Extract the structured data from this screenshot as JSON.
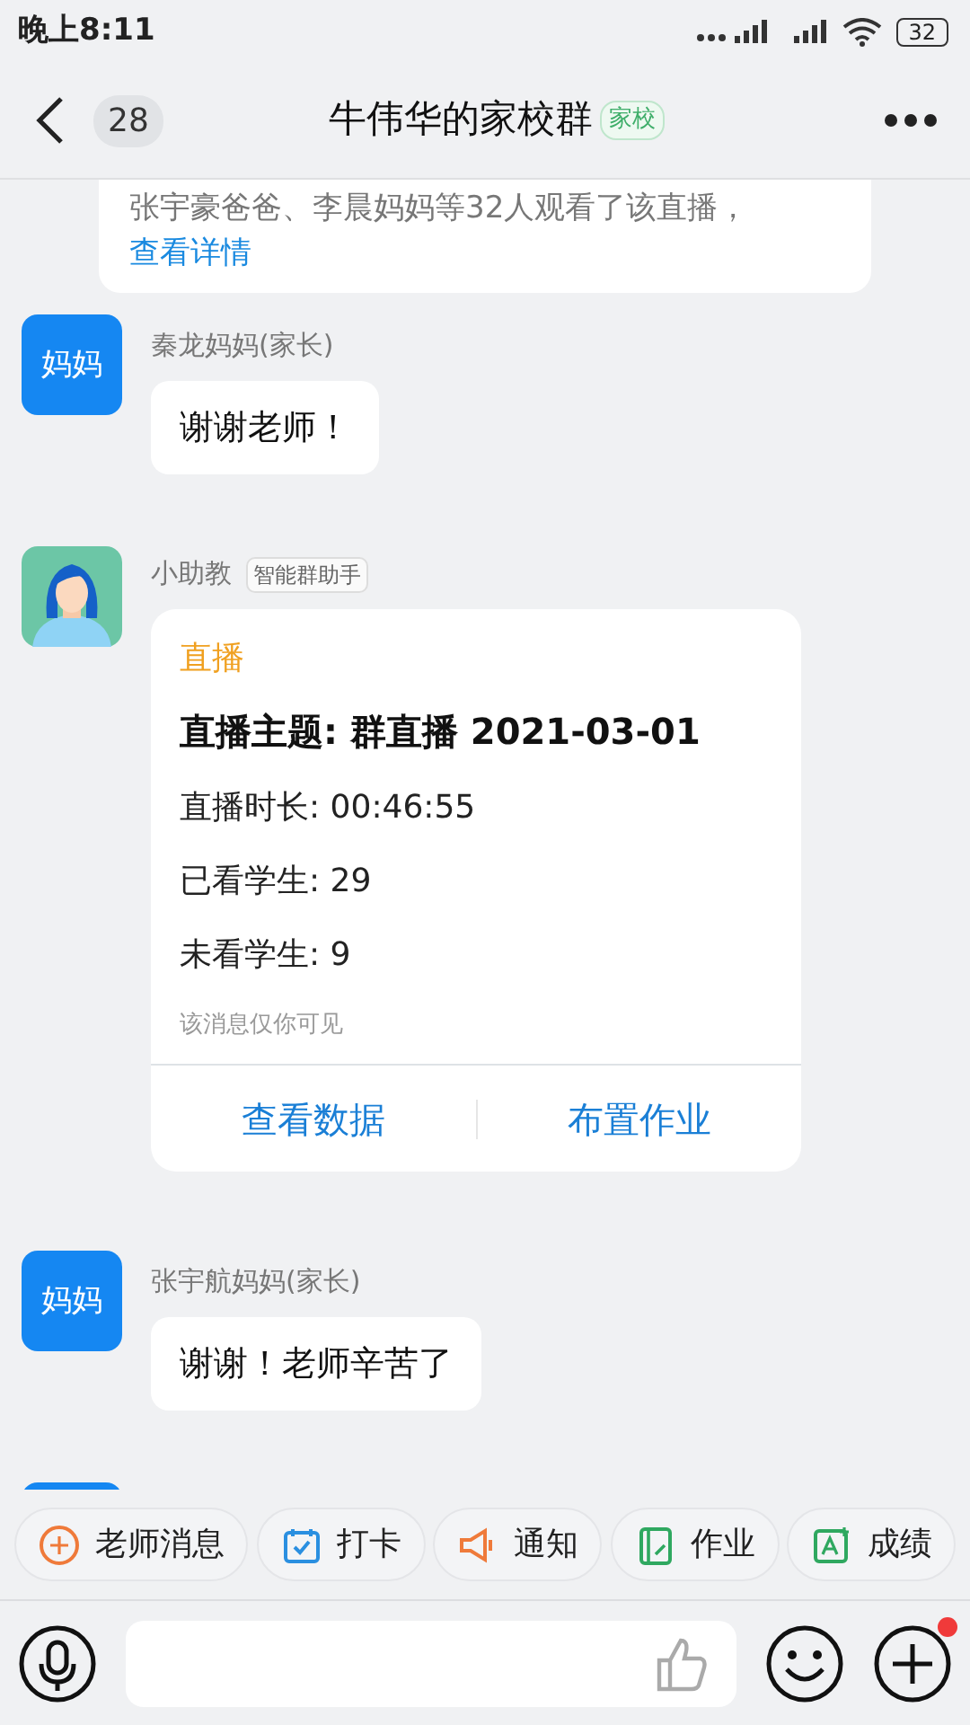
{
  "status_bar": {
    "time": "晚上8:11",
    "battery": "32"
  },
  "header": {
    "back_count": "28",
    "title": "牛伟华的家校群",
    "tag": "家校"
  },
  "messages": [
    {
      "kind": "notice",
      "text": "张宇豪爸爸、李晨妈妈等32人观看了该直播，",
      "link": "查看详情"
    },
    {
      "kind": "text",
      "avatar": "妈妈",
      "sender": "秦龙妈妈(家长)",
      "text": "谢谢老师！"
    },
    {
      "kind": "card",
      "sender": "小助教",
      "sender_tag": "智能群助手",
      "card": {
        "label": "直播",
        "title": "直播主题: 群直播 2021-03-01",
        "lines": [
          "直播时长: 00:46:55",
          "已看学生: 29",
          "未看学生: 9"
        ],
        "note": "该消息仅你可见",
        "actions": [
          "查看数据",
          "布置作业"
        ]
      }
    },
    {
      "kind": "text",
      "avatar": "妈妈",
      "sender": "张宇航妈妈(家长)",
      "text": "谢谢！老师辛苦了"
    },
    {
      "kind": "partial"
    }
  ],
  "quick_actions": [
    {
      "label": "老师消息"
    },
    {
      "label": "打卡"
    },
    {
      "label": "通知"
    },
    {
      "label": "作业"
    },
    {
      "label": "成绩"
    }
  ],
  "composer": {
    "plus_badge": true
  }
}
